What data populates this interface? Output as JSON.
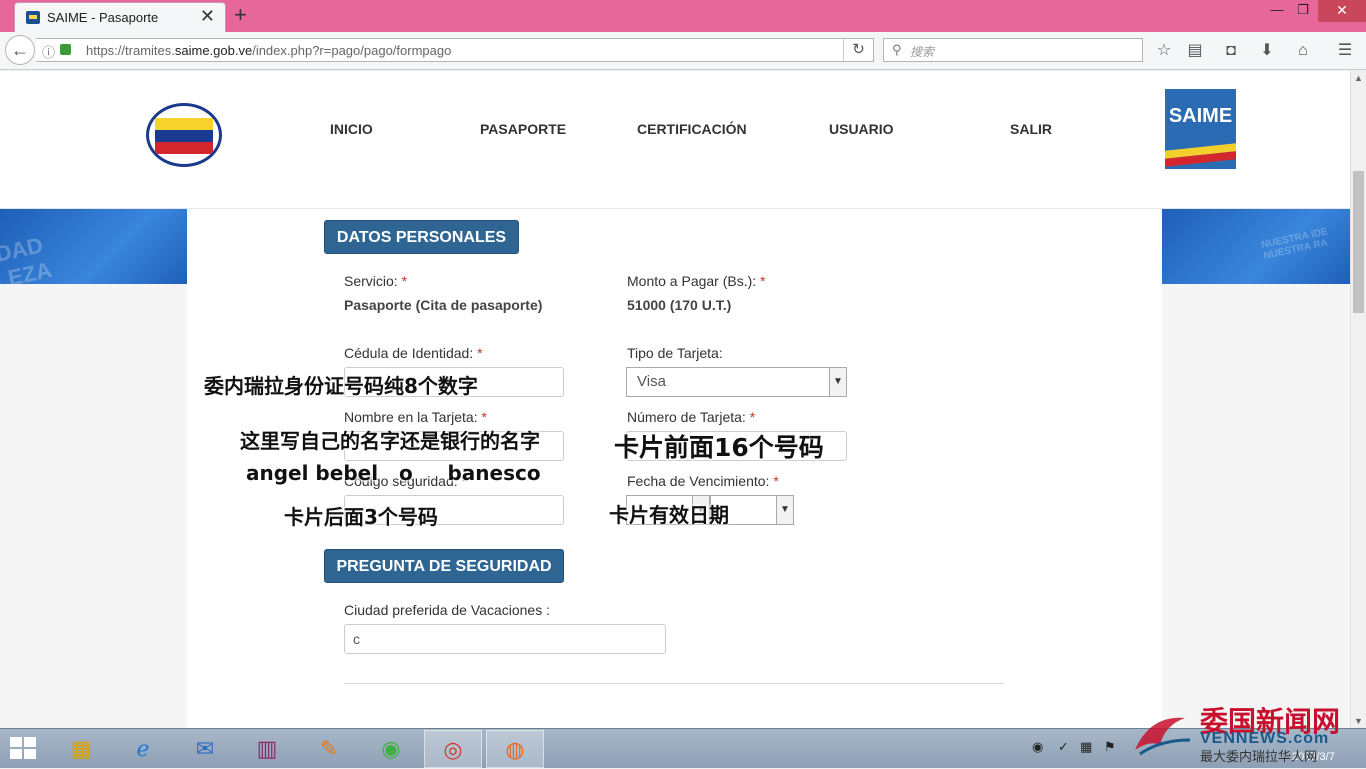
{
  "browser": {
    "tab_title": "SAIME - Pasaporte",
    "tab_close": "✕",
    "new_tab": "+",
    "url_prefix": "https://tramites.",
    "url_domain": "saime.gob.ve",
    "url_path": "/index.php?r=pago/pago/formpago",
    "search_placeholder": "搜索",
    "window_minimize": "—",
    "window_restore": "❐",
    "window_close": "✕"
  },
  "header": {
    "menu": [
      "INICIO",
      "PASAPORTE",
      "CERTIFICACIÓN",
      "USUARIO",
      "SALIR"
    ],
    "logo_right_text": "SAIME"
  },
  "form": {
    "section_personal": "DATOS PERSONALES",
    "servicio_label": "Servicio:",
    "servicio_value": "Pasaporte (Cita de pasaporte)",
    "monto_label": "Monto a Pagar (Bs.):",
    "monto_value": "51000 (170 U.T.)",
    "cedula_label": "Cédula de Identidad:",
    "tipo_label": "Tipo de Tarjeta:",
    "tipo_value": "Visa",
    "nombre_label": "Nombre en la Tarjeta:",
    "numero_label": "Número de Tarjeta:",
    "codigo_label": "Código seguridad:",
    "fecha_label": "Fecha de Vencimiento:",
    "required_mark": "*",
    "section_security": "PREGUNTA DE SEGURIDAD",
    "ciudad_label": "Ciudad preferida de Vacaciones :",
    "ciudad_value": "c"
  },
  "annotations": {
    "cedula_note": "委内瑞拉身份证号码纯8个数字",
    "nombre_note": "这里写自己的名字还是银行的名字",
    "nombre_example": "angel bebel   o     banesco",
    "numero_note": "卡片前面16个号码",
    "codigo_note": "卡片后面3个号码",
    "fecha_note": "卡片有效日期"
  },
  "taskbar": {
    "apps": [
      "explorer",
      "ie",
      "mail",
      "winrar",
      "paint",
      "wechat",
      "chrome",
      "firefox"
    ],
    "clock_date": "2017/3/7"
  },
  "watermark": {
    "title": "委国新闻网",
    "domain": "VENNEWS.com",
    "subtitle": "最大委内瑞拉华人网"
  },
  "colors": {
    "tab_bar": "#e8679a",
    "section_button": "#2e6592",
    "required": "#c0392b",
    "banner": "#3a86dc"
  }
}
